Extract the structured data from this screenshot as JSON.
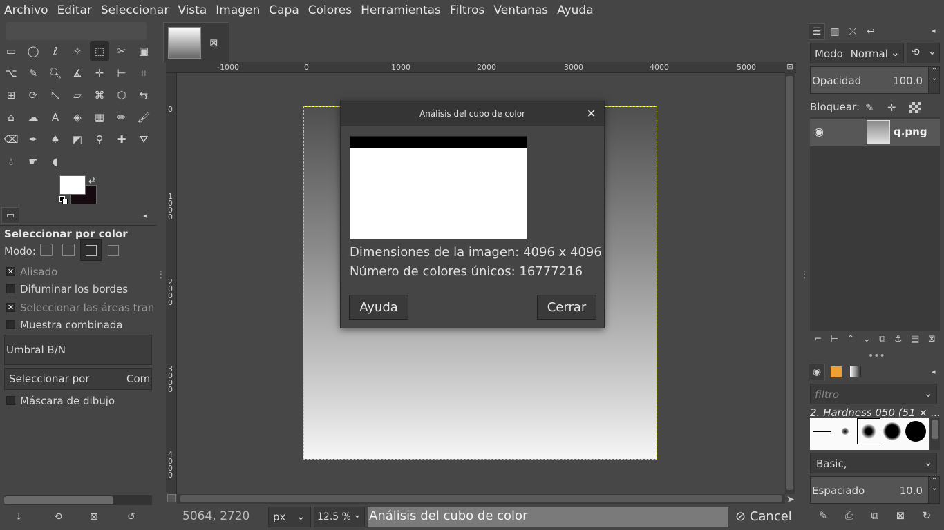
{
  "menubar": {
    "items": [
      "Archivo",
      "Editar",
      "Seleccionar",
      "Vista",
      "Imagen",
      "Capa",
      "Colores",
      "Herramientas",
      "Filtros",
      "Ventanas",
      "Ayuda"
    ]
  },
  "tool_options": {
    "title": "Seleccionar por color",
    "mode_label": "Modo:",
    "antialias": "Alisado",
    "feather": "Difuminar los bordes",
    "select_transparent": "Seleccionar las áreas tran",
    "sample_merged": "Muestra combinada",
    "threshold": "Umbral B/N",
    "select_by_label": "Seleccionar por",
    "select_by_value": "Comp",
    "draw_mask": "Máscara de dibujo"
  },
  "rulers": {
    "top": [
      "-1000",
      "0",
      "1000",
      "2000",
      "3000",
      "4000",
      "5000"
    ],
    "left": [
      "0",
      "1\n0\n0\n0",
      "2\n0\n0\n0",
      "3\n0\n0\n0",
      "4\n0\n0\n0"
    ]
  },
  "dialog": {
    "title": "Análisis del cubo de color",
    "dimensions": "Dimensiones de la imagen: 4096 x 4096",
    "unique_colors": "Número de colores únicos: 16777216",
    "help_button": "Ayuda",
    "close_button": "Cerrar"
  },
  "statusbar": {
    "coords": "5064, 2720",
    "unit": "px",
    "zoom": "12.5 %",
    "message": "Análisis del cubo de color",
    "cancel": "Cancel"
  },
  "layers": {
    "mode_label": "Modo",
    "mode_value": "Normal",
    "opacity_label": "Opacidad",
    "opacity_value": "100.0",
    "lock_label": "Bloquear:",
    "layer_name": "q.png"
  },
  "brushes": {
    "filter_placeholder": "filtro",
    "current_brush": "2. Hardness 050 (51 × ...",
    "preset": "Basic,",
    "spacing_label": "Espaciado",
    "spacing_value": "10.0"
  },
  "colors": {
    "foreground": "#ffffff",
    "background": "#140a10",
    "selection_marquee": "#d8d800"
  }
}
